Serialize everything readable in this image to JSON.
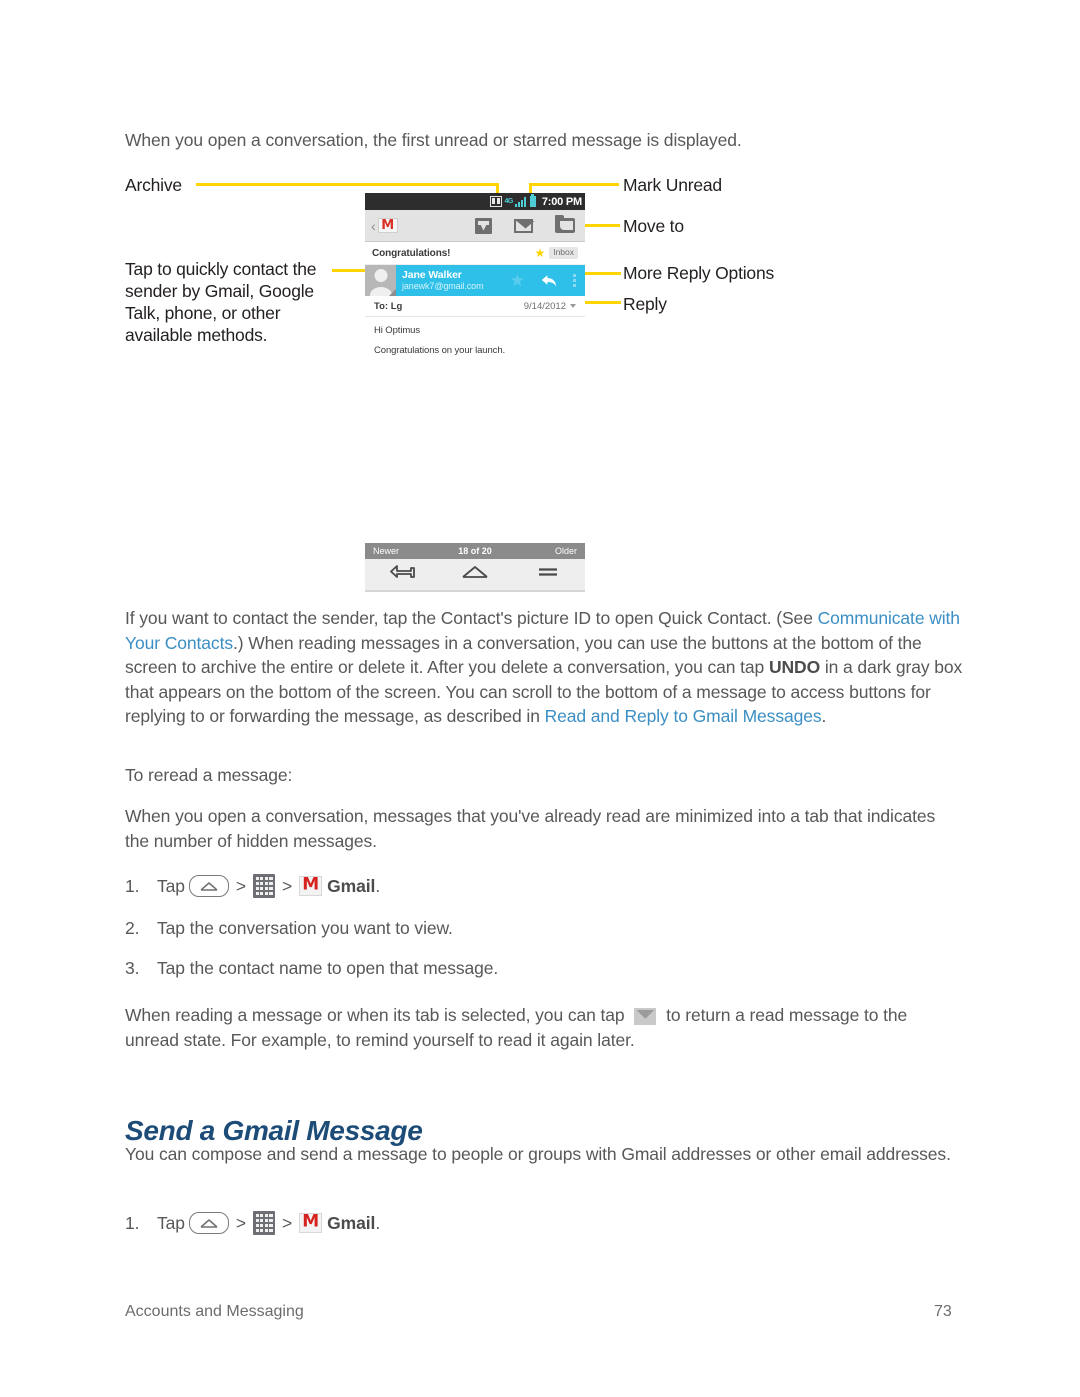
{
  "page": {
    "intro": "When you open a conversation, the first unread or starred message is displayed.",
    "footer_section": "Accounts and Messaging",
    "footer_page_number": "73"
  },
  "callouts": {
    "archive": "Archive",
    "quick_contact": "Tap to quickly contact the sender by Gmail, Google Talk, phone, or other available methods.",
    "mark_unread": "Mark Unread",
    "move_to": "Move to",
    "more_reply_options": "More Reply Options",
    "reply": "Reply"
  },
  "phone_screenshot": {
    "status_bar": {
      "network": "4G",
      "time": "7:00 PM",
      "icons": [
        "sd-card-icon",
        "signal-bars-icon",
        "battery-icon"
      ]
    },
    "action_bar": {
      "app_icon": "gmail-icon",
      "actions": [
        "archive-icon",
        "mark-unread-icon",
        "move-to-folder-icon"
      ]
    },
    "subject": "Congratulations!",
    "label": "Inbox",
    "sender_name": "Jane Walker",
    "sender_email": "janewk7@gmail.com",
    "recipient": "To: Lg",
    "date": "9/14/2012",
    "message_greeting": "Hi Optimus",
    "message_body": "Congratulations on your launch.",
    "accent_color": "#2ec0e8"
  },
  "nav_screenshot": {
    "newer": "Newer",
    "counter": "18 of 20",
    "older": "Older",
    "buttons": [
      "back-icon",
      "home-icon",
      "menu-icon"
    ]
  },
  "paragraphs": {
    "contact_sender_1": "If you want to contact the sender, tap the Contact's picture ID to open Quick Contact. (See ",
    "contact_sender_link1": "Communicate with Your Contacts",
    "contact_sender_2": ".) When reading messages in a conversation, you can use the buttons at the bottom of the screen to archive the entire or delete it. After you delete a conversation, you can tap ",
    "undo": "UNDO",
    "contact_sender_3": " in a dark gray box that appears on the bottom of the screen. You can scroll to the bottom of a message to access buttons for replying to or forwarding the message, as described in ",
    "contact_sender_link2": "Read and Reply to Gmail Messages",
    "contact_sender_4": ".",
    "reread_intro": "To reread a message:",
    "reread_desc": "When you open a conversation, messages that you've already read are minimized into a tab that indicates the number of hidden messages.",
    "mark_unread_tip_1": "When reading a message or when its tab is selected, you can tap ",
    "mark_unread_tip_2": " to return a read message to the unread state. For example, to remind yourself to read it again later.",
    "send_intro": "You can compose and send a message to people or groups with Gmail addresses or other email addresses."
  },
  "headings": {
    "send_a_gmail_message": "Send a Gmail Message"
  },
  "steps_reread": [
    {
      "num": "1.",
      "pre": "Tap",
      "app": "Gmail",
      "post": "."
    },
    {
      "num": "2.",
      "text": "Tap the conversation you want to view."
    },
    {
      "num": "3.",
      "text": "Tap the contact name to open that message."
    }
  ],
  "steps_send": [
    {
      "num": "1.",
      "pre": "Tap",
      "app": "Gmail",
      "post": "."
    }
  ],
  "colors": {
    "link": "#3c8fc4",
    "heading": "#1c4c77",
    "callout_line": "#ffd400",
    "body_text": "#58585a"
  }
}
